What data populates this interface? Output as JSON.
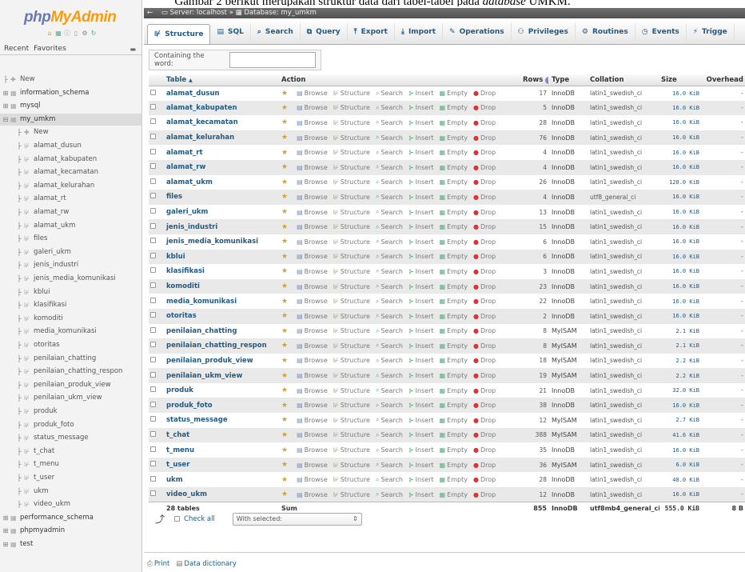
{
  "caption": {
    "text": "Gambar 2 berikut merupakan struktur data dari tabel-tabel pada ",
    "italic": "database",
    "suffix": " UMKM."
  },
  "logo": {
    "part1": "php",
    "part2": "MyAdmin"
  },
  "navigation": {
    "recent": "Recent",
    "favorites": "Favorites",
    "tree": [
      {
        "label": "New",
        "depth": 0,
        "type": "new"
      },
      {
        "label": "information_schema",
        "depth": 0,
        "type": "db"
      },
      {
        "label": "mysql",
        "depth": 0,
        "type": "db"
      },
      {
        "label": "my_umkm",
        "depth": 0,
        "type": "db",
        "selected": true
      },
      {
        "label": "New",
        "depth": 1,
        "type": "new"
      },
      {
        "label": "alamat_dusun",
        "depth": 1,
        "type": "table"
      },
      {
        "label": "alamat_kabupaten",
        "depth": 1,
        "type": "table"
      },
      {
        "label": "alamat_kecamatan",
        "depth": 1,
        "type": "table"
      },
      {
        "label": "alamat_kelurahan",
        "depth": 1,
        "type": "table"
      },
      {
        "label": "alamat_rt",
        "depth": 1,
        "type": "table"
      },
      {
        "label": "alamat_rw",
        "depth": 1,
        "type": "table"
      },
      {
        "label": "alamat_ukm",
        "depth": 1,
        "type": "table"
      },
      {
        "label": "files",
        "depth": 1,
        "type": "table"
      },
      {
        "label": "galeri_ukm",
        "depth": 1,
        "type": "table"
      },
      {
        "label": "jenis_industri",
        "depth": 1,
        "type": "table"
      },
      {
        "label": "jenis_media_komunikasi",
        "depth": 1,
        "type": "table"
      },
      {
        "label": "kblui",
        "depth": 1,
        "type": "table"
      },
      {
        "label": "klasifikasi",
        "depth": 1,
        "type": "table"
      },
      {
        "label": "komoditi",
        "depth": 1,
        "type": "table"
      },
      {
        "label": "media_komunikasi",
        "depth": 1,
        "type": "table"
      },
      {
        "label": "otoritas",
        "depth": 1,
        "type": "table"
      },
      {
        "label": "penilaian_chatting",
        "depth": 1,
        "type": "table"
      },
      {
        "label": "penilaian_chatting_respon",
        "depth": 1,
        "type": "table"
      },
      {
        "label": "penilaian_produk_view",
        "depth": 1,
        "type": "table"
      },
      {
        "label": "penilaian_ukm_view",
        "depth": 1,
        "type": "table"
      },
      {
        "label": "produk",
        "depth": 1,
        "type": "table"
      },
      {
        "label": "produk_foto",
        "depth": 1,
        "type": "table"
      },
      {
        "label": "status_message",
        "depth": 1,
        "type": "table"
      },
      {
        "label": "t_chat",
        "depth": 1,
        "type": "table"
      },
      {
        "label": "t_menu",
        "depth": 1,
        "type": "table"
      },
      {
        "label": "t_user",
        "depth": 1,
        "type": "table"
      },
      {
        "label": "ukm",
        "depth": 1,
        "type": "table"
      },
      {
        "label": "video_ukm",
        "depth": 1,
        "type": "table"
      },
      {
        "label": "performance_schema",
        "depth": 0,
        "type": "db"
      },
      {
        "label": "phpmyadmin",
        "depth": 0,
        "type": "db"
      },
      {
        "label": "test",
        "depth": 0,
        "type": "db"
      }
    ]
  },
  "breadcrumb": {
    "server": "Server: localhost",
    "sep": "»",
    "database": "Database: my_umkm"
  },
  "tabs": [
    {
      "label": "Structure",
      "icon": "structure-icon",
      "glyph": "⊮",
      "active": true
    },
    {
      "label": "SQL",
      "icon": "sql-icon",
      "glyph": "▤"
    },
    {
      "label": "Search",
      "icon": "search-icon",
      "glyph": "⌕"
    },
    {
      "label": "Query",
      "icon": "query-icon",
      "glyph": "⧉"
    },
    {
      "label": "Export",
      "icon": "export-icon",
      "glyph": "⤒"
    },
    {
      "label": "Import",
      "icon": "import-icon",
      "glyph": "⤓"
    },
    {
      "label": "Operations",
      "icon": "operations-icon",
      "glyph": "✎"
    },
    {
      "label": "Privileges",
      "icon": "privileges-icon",
      "glyph": "⚇"
    },
    {
      "label": "Routines",
      "icon": "routines-icon",
      "glyph": "⚙"
    },
    {
      "label": "Events",
      "icon": "events-icon",
      "glyph": "◷"
    },
    {
      "label": "Trigge",
      "icon": "triggers-icon",
      "glyph": "⚡"
    }
  ],
  "filter": {
    "label": "Containing the word:",
    "value": ""
  },
  "table": {
    "headers": {
      "table": "Table",
      "sort": "▲",
      "action": "Action",
      "rows": "Rows",
      "help": "?",
      "type": "Type",
      "collation": "Collation",
      "size": "Size",
      "overhead": "Overhead"
    },
    "actions": {
      "browse": "Browse",
      "structure": "Structure",
      "search": "Search",
      "insert": "Insert",
      "empty": "Empty",
      "drop": "Drop"
    },
    "rows": [
      {
        "name": "alamat_dusun",
        "rows": "17",
        "type": "InnoDB",
        "collation": "latin1_swedish_ci",
        "size": "16.0 KiB",
        "overhead": "-"
      },
      {
        "name": "alamat_kabupaten",
        "rows": "5",
        "type": "InnoDB",
        "collation": "latin1_swedish_ci",
        "size": "16.0 KiB",
        "overhead": "-"
      },
      {
        "name": "alamat_kecamatan",
        "rows": "28",
        "type": "InnoDB",
        "collation": "latin1_swedish_ci",
        "size": "16.0 KiB",
        "overhead": "-"
      },
      {
        "name": "alamat_kelurahan",
        "rows": "76",
        "type": "InnoDB",
        "collation": "latin1_swedish_ci",
        "size": "16.0 KiB",
        "overhead": "-"
      },
      {
        "name": "alamat_rt",
        "rows": "4",
        "type": "InnoDB",
        "collation": "latin1_swedish_ci",
        "size": "16.0 KiB",
        "overhead": "-"
      },
      {
        "name": "alamat_rw",
        "rows": "4",
        "type": "InnoDB",
        "collation": "latin1_swedish_ci",
        "size": "16.0 KiB",
        "overhead": "-"
      },
      {
        "name": "alamat_ukm",
        "rows": "26",
        "type": "InnoDB",
        "collation": "latin1_swedish_ci",
        "size": "128.0 KiB",
        "overhead": "-"
      },
      {
        "name": "files",
        "rows": "4",
        "type": "InnoDB",
        "collation": "utf8_general_ci",
        "size": "16.0 KiB",
        "overhead": "-"
      },
      {
        "name": "galeri_ukm",
        "rows": "13",
        "type": "InnoDB",
        "collation": "latin1_swedish_ci",
        "size": "16.0 KiB",
        "overhead": "-"
      },
      {
        "name": "jenis_industri",
        "rows": "15",
        "type": "InnoDB",
        "collation": "latin1_swedish_ci",
        "size": "16.0 KiB",
        "overhead": "-"
      },
      {
        "name": "jenis_media_komunikasi",
        "rows": "6",
        "type": "InnoDB",
        "collation": "latin1_swedish_ci",
        "size": "16.0 KiB",
        "overhead": "-"
      },
      {
        "name": "kblui",
        "rows": "6",
        "type": "InnoDB",
        "collation": "latin1_swedish_ci",
        "size": "16.0 KiB",
        "overhead": "-"
      },
      {
        "name": "klasifikasi",
        "rows": "3",
        "type": "InnoDB",
        "collation": "latin1_swedish_ci",
        "size": "16.0 KiB",
        "overhead": "-"
      },
      {
        "name": "komoditi",
        "rows": "23",
        "type": "InnoDB",
        "collation": "latin1_swedish_ci",
        "size": "16.0 KiB",
        "overhead": "-"
      },
      {
        "name": "media_komunikasi",
        "rows": "22",
        "type": "InnoDB",
        "collation": "latin1_swedish_ci",
        "size": "16.0 KiB",
        "overhead": "-"
      },
      {
        "name": "otoritas",
        "rows": "2",
        "type": "InnoDB",
        "collation": "latin1_swedish_ci",
        "size": "16.0 KiB",
        "overhead": "-"
      },
      {
        "name": "penilaian_chatting",
        "rows": "8",
        "type": "MyISAM",
        "collation": "latin1_swedish_ci",
        "size": "2.1 KiB",
        "overhead": "-"
      },
      {
        "name": "penilaian_chatting_respon",
        "rows": "8",
        "type": "MyISAM",
        "collation": "latin1_swedish_ci",
        "size": "2.1 KiB",
        "overhead": "-"
      },
      {
        "name": "penilaian_produk_view",
        "rows": "18",
        "type": "MyISAM",
        "collation": "latin1_swedish_ci",
        "size": "2.2 KiB",
        "overhead": "-"
      },
      {
        "name": "penilaian_ukm_view",
        "rows": "19",
        "type": "MyISAM",
        "collation": "latin1_swedish_ci",
        "size": "2.2 KiB",
        "overhead": "-"
      },
      {
        "name": "produk",
        "rows": "21",
        "type": "InnoDB",
        "collation": "latin1_swedish_ci",
        "size": "32.0 KiB",
        "overhead": "-"
      },
      {
        "name": "produk_foto",
        "rows": "38",
        "type": "InnoDB",
        "collation": "latin1_swedish_ci",
        "size": "16.0 KiB",
        "overhead": "-"
      },
      {
        "name": "status_message",
        "rows": "12",
        "type": "MyISAM",
        "collation": "latin1_swedish_ci",
        "size": "2.7 KiB",
        "overhead": "-"
      },
      {
        "name": "t_chat",
        "rows": "388",
        "type": "MyISAM",
        "collation": "latin1_swedish_ci",
        "size": "41.6 KiB",
        "overhead": "-"
      },
      {
        "name": "t_menu",
        "rows": "35",
        "type": "InnoDB",
        "collation": "latin1_swedish_ci",
        "size": "16.0 KiB",
        "overhead": "-"
      },
      {
        "name": "t_user",
        "rows": "36",
        "type": "MyISAM",
        "collation": "latin1_swedish_ci",
        "size": "6.0 KiB",
        "overhead": "-"
      },
      {
        "name": "ukm",
        "rows": "28",
        "type": "InnoDB",
        "collation": "latin1_swedish_ci",
        "size": "48.0 KiB",
        "overhead": "-"
      },
      {
        "name": "video_ukm",
        "rows": "12",
        "type": "InnoDB",
        "collation": "latin1_swedish_ci",
        "size": "16.0 KiB",
        "overhead": "-"
      }
    ],
    "summary": {
      "tables": "28 tables",
      "label": "Sum",
      "rows": "855",
      "type": "InnoDB",
      "collation": "utf8mb4_general_ci",
      "size": "555.0 KiB",
      "overhead": "8 B"
    }
  },
  "bulk": {
    "check_all": "Check all",
    "with_selected": "With selected:"
  },
  "footer": {
    "print": "Print",
    "data_dictionary": "Data dictionary"
  },
  "colors": {
    "link": "#235a81",
    "logo_php": "#6c78af",
    "logo_myadmin": "#f89c0e",
    "row_alt": "#e9e9e9",
    "drop_icon": "#dd3333"
  }
}
